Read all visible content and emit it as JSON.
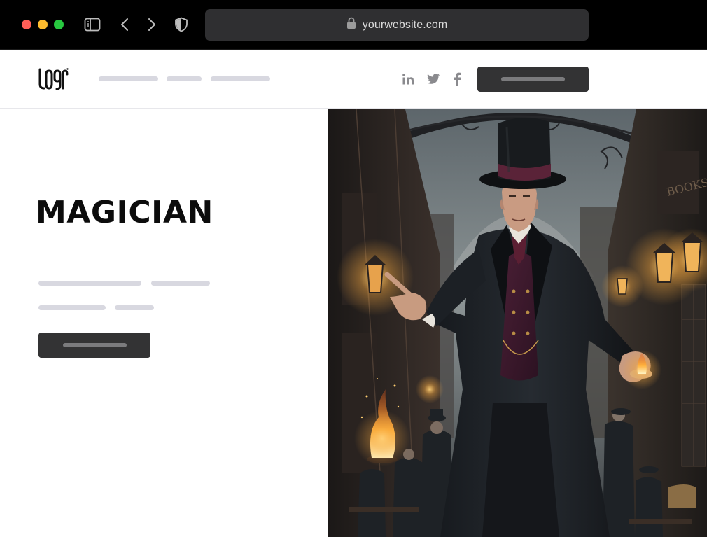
{
  "browser": {
    "url": "yourwebsite.com",
    "traffic_lights": {
      "close": "#ff5f57",
      "minimize": "#febc2e",
      "maximize": "#28c840"
    },
    "icons": [
      "sidebar-icon",
      "back-arrow-icon",
      "forward-arrow-icon",
      "shield-icon",
      "lock-icon"
    ]
  },
  "header": {
    "logo_text": "LOGO",
    "nav_placeholders": 3,
    "social": [
      "linkedin-icon",
      "twitter-icon",
      "facebook-icon"
    ],
    "cta_placeholder": true
  },
  "hero": {
    "title": "MAGICIAN",
    "cta_placeholder": true,
    "image_alt": "Victorian magician in a top hat gesturing in a lamp-lit street with a flame in his hand"
  },
  "colors": {
    "placeholder": "#d8d8e0",
    "button": "#333334",
    "button_bar": "#7b7b7d",
    "title": "#0c0c0c"
  }
}
